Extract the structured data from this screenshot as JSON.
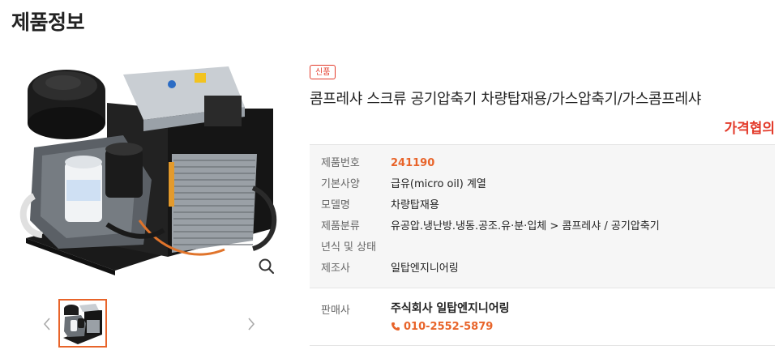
{
  "page": {
    "title": "제품정보"
  },
  "gallery": {
    "main_image_icon": "compressor-unit-image",
    "zoom_icon": "magnifier-icon",
    "prev_icon": "chevron-left-icon",
    "next_icon": "chevron-right-icon"
  },
  "product": {
    "badge": "신품",
    "name": "콤프레샤 스크류 공기압축기 차량탑재용/가스압축기/가스콤프레샤",
    "price": "가격협의",
    "accent_color": "#e8642a",
    "price_color": "#e33b2b"
  },
  "specs": [
    {
      "label": "제품번호",
      "value": "241190"
    },
    {
      "label": "기본사양",
      "value": "급유(micro oil) 계열"
    },
    {
      "label": "모델명",
      "value": "차량탑재용"
    },
    {
      "label": "제품분류",
      "value": "유공압.냉난방.냉동.공조.유·분·입체 > 콤프레샤 / 공기압축기"
    },
    {
      "label": "년식 및 상태",
      "value": ""
    },
    {
      "label": "제조사",
      "value": "일탑엔지니어링"
    }
  ],
  "seller": {
    "label": "판매사",
    "name": "주식회사 일탑엔지니어링",
    "phone": "010-2552-5879",
    "phone_icon": "phone-icon"
  }
}
